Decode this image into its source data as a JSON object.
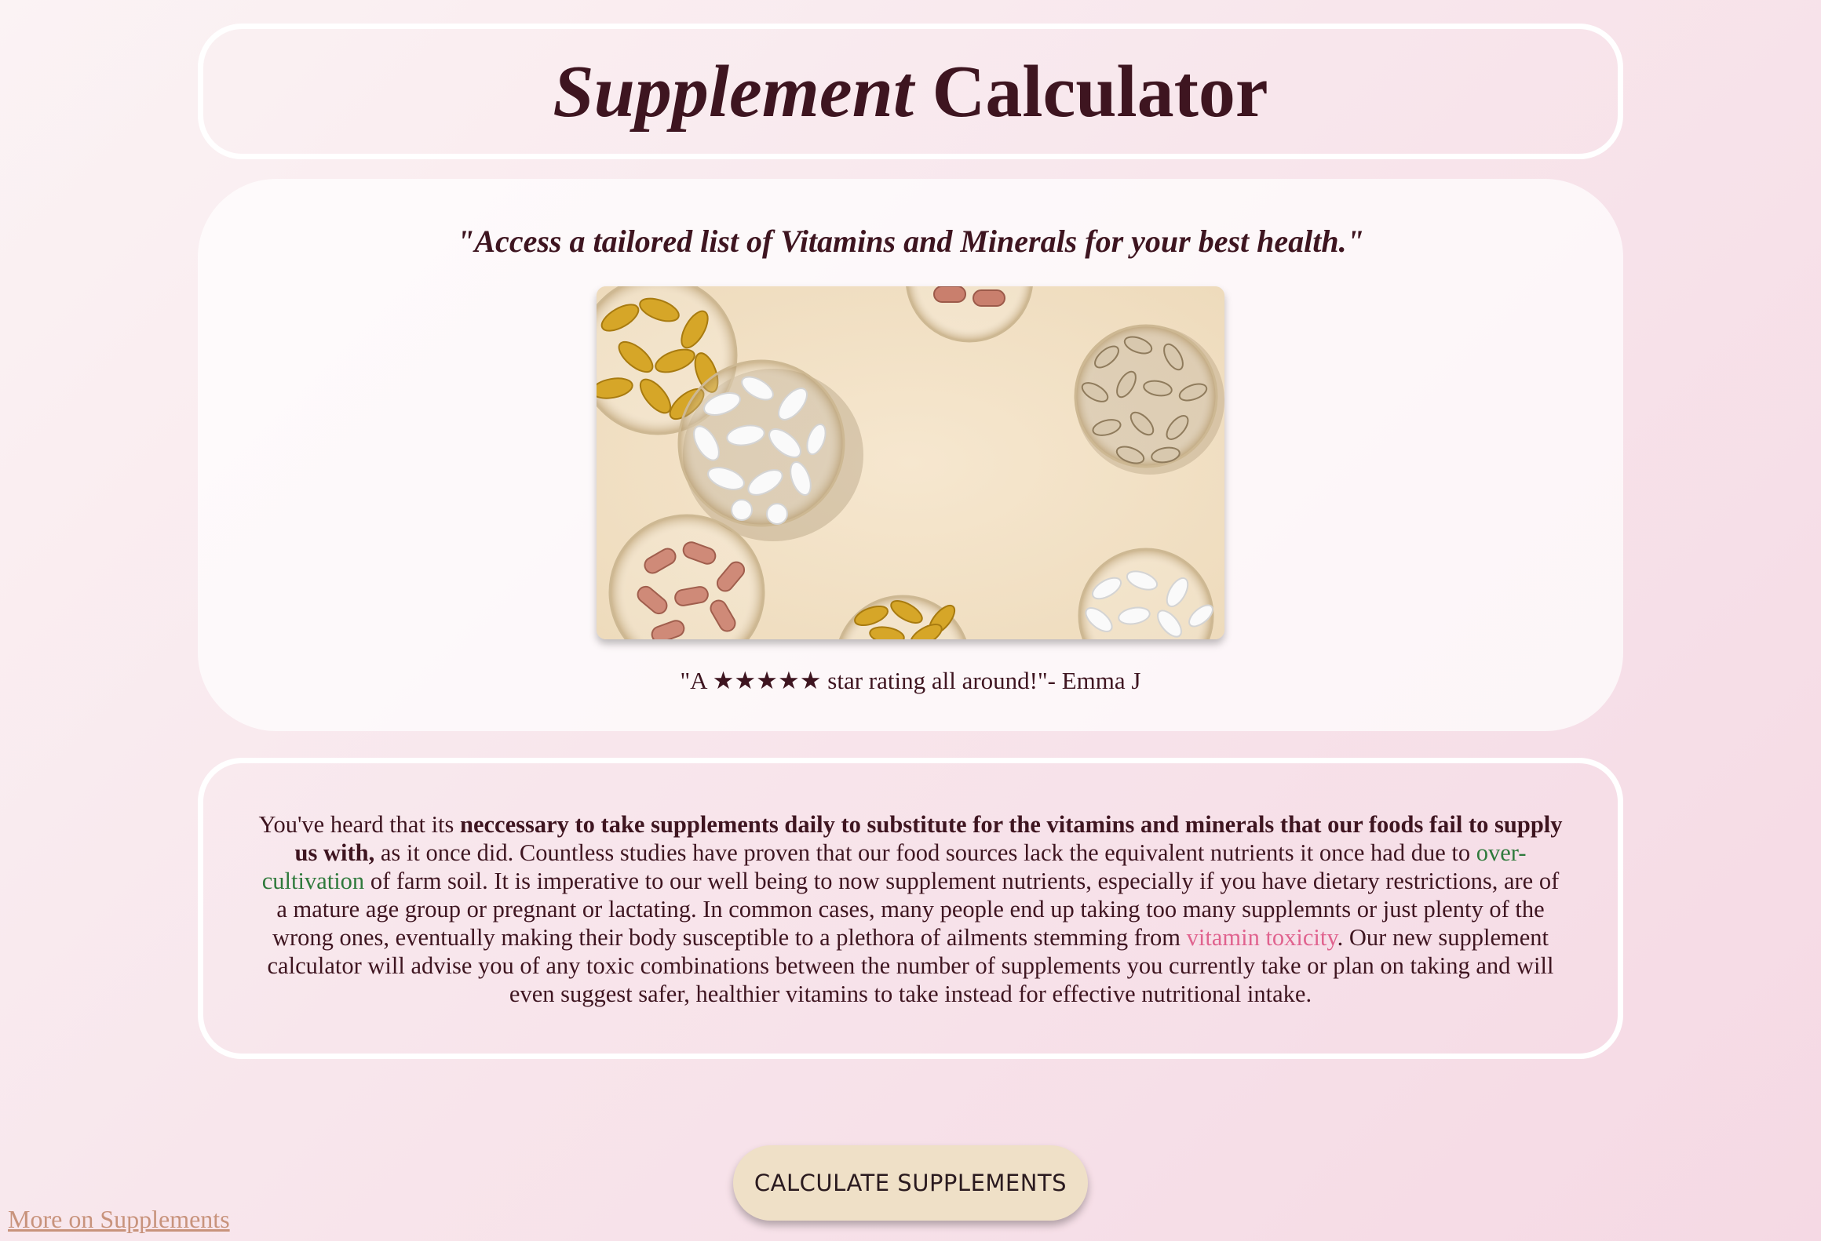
{
  "header": {
    "title_italic": "Supplement",
    "title_rest": " Calculator"
  },
  "hero": {
    "tagline": "\"Access a tailored list of Vitamins and Minerals for your best health.\"",
    "testimonial": "\"A ★★★★★ star rating all around!\"- Emma J"
  },
  "info": {
    "part1": "You've heard that its ",
    "bold": "neccessary to take supplements daily to substitute for the vitamins and minerals that our foods fail to supply us with,",
    "part2": " as it once did. Countless studies have proven that our food sources lack the equivalent nutrients it once had due to ",
    "link1": "over-cultivation",
    "part3": " of farm soil. It is imperative to our well being to now supplement nutrients, especially if you have dietary restrictions, are of a mature age group or pregnant or lactating. In common cases, many people end up taking too many supplemnts or just plenty of the wrong ones, eventually making their body susceptible to a plethora of ailments stemming from ",
    "link2": "vitamin toxicity",
    "part4": ". Our new supplement calculator will advise you of any toxic combinations between the number of supplements you currently take or plan on taking and will even suggest safer, healthier vitamins to take instead for effective nutritional intake."
  },
  "actions": {
    "calculate_label": "CALCULATE SUPPLEMENTS",
    "more_link": "More on Supplements"
  },
  "colors": {
    "heading": "#3e1520",
    "link_green": "#2f7a3c",
    "link_pink": "#e0628e",
    "button_bg": "#efe0c7",
    "more_link": "#c8937c"
  },
  "icons": {
    "hero_image": "supplement-bowls-image"
  }
}
